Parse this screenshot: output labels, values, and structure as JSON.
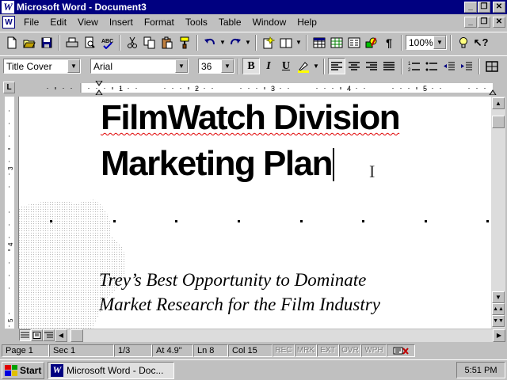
{
  "window": {
    "title": "Microsoft Word - Document3",
    "app_icon_glyph": "W"
  },
  "menu": {
    "items": [
      "File",
      "Edit",
      "View",
      "Insert",
      "Format",
      "Tools",
      "Table",
      "Window",
      "Help"
    ]
  },
  "toolbar": {
    "zoom": "100%",
    "style": "Title Cover",
    "font": "Arial",
    "size": "36",
    "bold": "B",
    "italic": "I",
    "underline": "U",
    "icons": [
      "new-icon",
      "open-icon",
      "save-icon",
      "print-icon",
      "print-preview-icon",
      "spelling-icon",
      "cut-icon",
      "copy-icon",
      "paste-icon",
      "format-painter-icon",
      "undo-icon",
      "redo-icon",
      "autoformat-icon",
      "insert-address-icon",
      "insert-table-icon",
      "insert-excel-icon",
      "columns-icon",
      "drawing-icon",
      "show-paragraph-icon",
      "tip-wizard-icon",
      "help-icon",
      "highlight-icon",
      "align-left-icon",
      "center-icon",
      "align-right-icon",
      "justify-icon",
      "numbering-icon",
      "bullets-icon",
      "decrease-indent-icon",
      "increase-indent-icon",
      "borders-icon"
    ]
  },
  "ruler": {
    "tab_selector": "L",
    "numbers": [
      "1",
      "2",
      "3",
      "4",
      "5"
    ]
  },
  "vertical_ruler": {
    "numbers": [
      "3",
      "4",
      "5"
    ]
  },
  "document": {
    "title_line1": "FilmWatch Division",
    "title_line2": "Marketing Plan",
    "subtitle_line1": "Trey’s Best Opportunity to Dominate",
    "subtitle_line2": "Market Research for the Film Industry"
  },
  "status": {
    "page": "Page 1",
    "sec": "Sec 1",
    "pages": "1/3",
    "at": "At 4.9\"",
    "ln": "Ln 8",
    "col": "Col 15",
    "rec": "REC",
    "mrk": "MRK",
    "ext": "EXT",
    "ovr": "OVR",
    "wph": "WPH"
  },
  "taskbar": {
    "start": "Start",
    "task": "Microsoft Word - Doc...",
    "time": "5:51 PM"
  },
  "colors": {
    "title_bar": "#000080",
    "face": "#c0c0c0",
    "spelling_underline": "#e00000"
  }
}
